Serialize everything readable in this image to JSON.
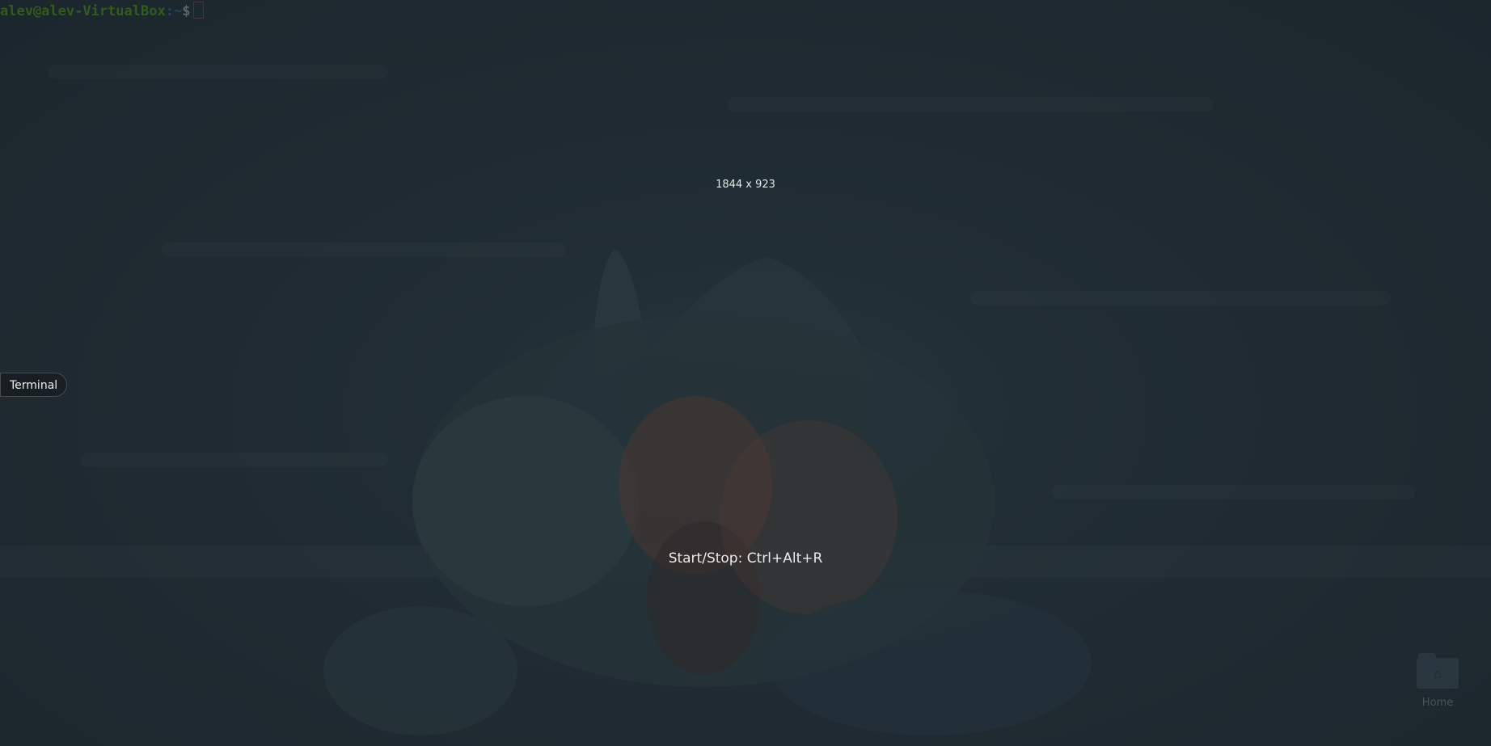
{
  "terminal": {
    "user_host": "alev@alev-VirtualBox",
    "path": ":~",
    "prompt_symbol": "$"
  },
  "overlay": {
    "resolution": "1844 x 923",
    "recording_hint": "Start/Stop: Ctrl+Alt+R"
  },
  "window_label": {
    "text": "Terminal"
  },
  "desktop": {
    "home_label": "Home",
    "home_icon": "home-folder-icon"
  },
  "colors": {
    "background": "#1e2a32",
    "prompt_user": "#4e9a06",
    "prompt_path": "#3465a4",
    "cursor": "#8a3a5a"
  }
}
